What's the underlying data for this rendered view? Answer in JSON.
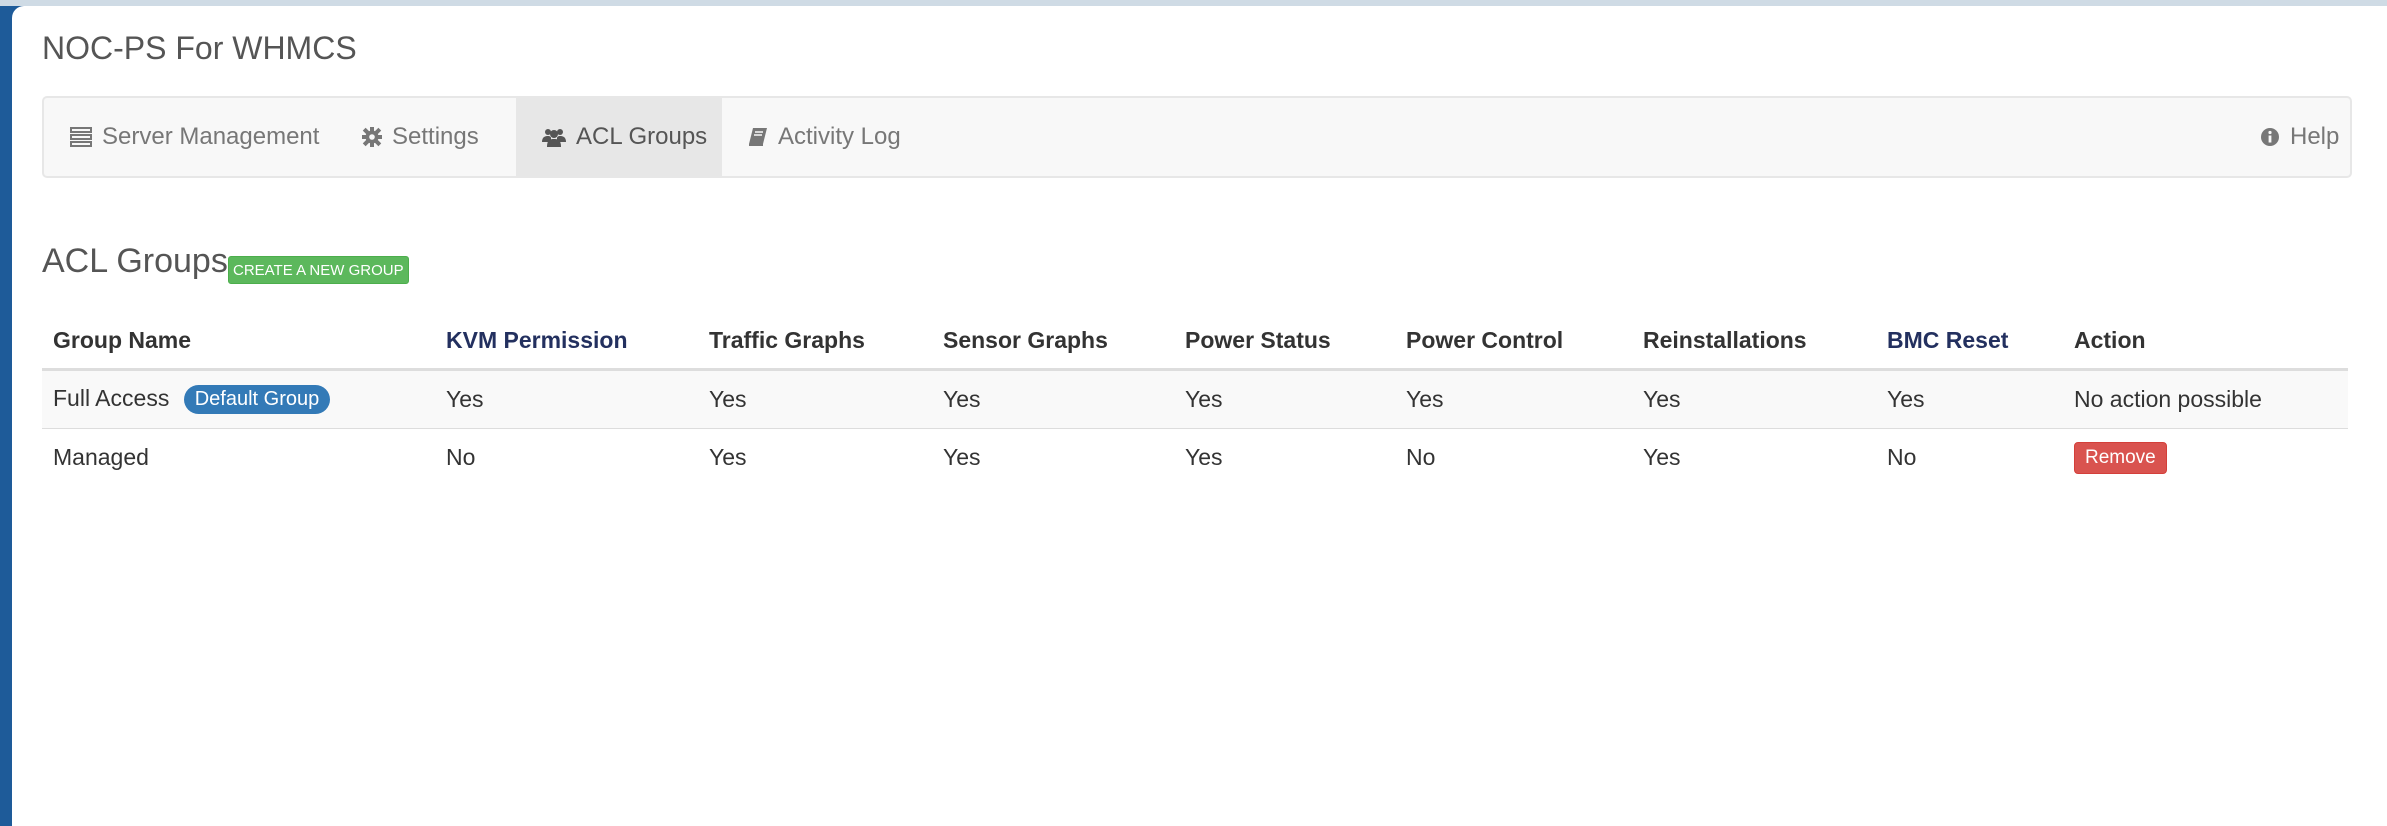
{
  "page": {
    "title": "NOC-PS For WHMCS"
  },
  "nav": {
    "server_management": "Server Management",
    "settings": "Settings",
    "acl_groups": "ACL Groups",
    "activity_log": "Activity Log",
    "help": "Help"
  },
  "section": {
    "title": "ACL Groups",
    "create_label": "CREATE A NEW GROUP"
  },
  "table": {
    "headers": {
      "group_name": "Group Name",
      "kvm": "KVM Permission",
      "traffic": "Traffic Graphs",
      "sensor": "Sensor Graphs",
      "power_status": "Power Status",
      "power_control": "Power Control",
      "reinstall": "Reinstallations",
      "bmc": "BMC Reset",
      "action": "Action"
    },
    "rows": [
      {
        "name": "Full Access",
        "badge": "Default Group",
        "kvm": "Yes",
        "traffic": "Yes",
        "sensor": "Yes",
        "power_status": "Yes",
        "power_control": "Yes",
        "reinstall": "Yes",
        "bmc": "Yes",
        "action": "No action possible"
      },
      {
        "name": "Managed",
        "kvm": "No",
        "traffic": "Yes",
        "sensor": "Yes",
        "power_status": "Yes",
        "power_control": "No",
        "reinstall": "Yes",
        "bmc": "No",
        "action": "Remove"
      }
    ]
  },
  "icons": {
    "server_management": "server-list-icon",
    "settings": "gear-icon",
    "acl_groups": "users-icon",
    "activity_log": "book-icon",
    "help": "info-circle-icon"
  },
  "colors": {
    "page_background": "#1e5b99",
    "link_header": "#23305f",
    "create_button": "#5cb85c",
    "default_badge": "#337ab7",
    "remove_button": "#d9534f"
  }
}
